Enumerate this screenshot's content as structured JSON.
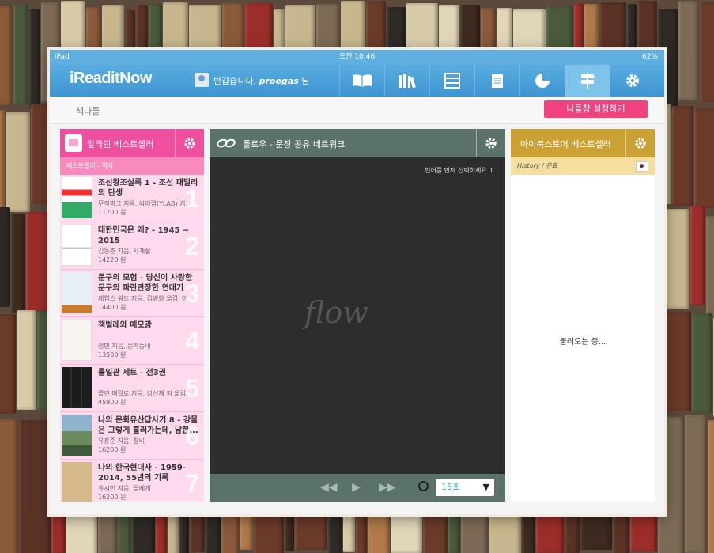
{
  "status_bar": {
    "device": "iPad",
    "time": "오전 10:46",
    "battery": "62%"
  },
  "header": {
    "logo": "iReaditNow",
    "greeting": "반갑습니다,",
    "username": "proegas",
    "honorific": "님"
  },
  "nav_tabs": [
    "book-icon",
    "library-icon",
    "shelf-icon",
    "notes-icon",
    "chart-icon",
    "signpost-icon",
    "settings-icon"
  ],
  "subbar": {
    "title": "책나들",
    "setup_button": "나들창 설정하기"
  },
  "left_panel": {
    "title": "알라딘 베스트셀러",
    "subtitle": "베스트셀러 - 역사",
    "items": [
      {
        "rank": "1",
        "title": "조선왕조실록 1 - 조선 패밀리의 탄생",
        "author": "무적핑크 지음, 와이랩(YLAB) 기...",
        "price": "11700 원"
      },
      {
        "rank": "2",
        "title": "대한민국은 왜? - 1945 ~ 2015",
        "author": "김동춘 지음, 사계절",
        "price": "14220 원"
      },
      {
        "rank": "3",
        "title": "문구의 모험 - 당신이 사랑한 문구의 파란만장한 연대기",
        "author": "제임스 워드 지음, 김병화 옮김, 어...",
        "price": "14400 원"
      },
      {
        "rank": "4",
        "title": "책벌레와 메모광",
        "author": "정민 지음, 문학동네",
        "price": "13500 원"
      },
      {
        "rank": "5",
        "title": "롤일관 세트 - 전3권",
        "author": "콜린 매컬로 지음, 강선재 외 옮김...",
        "price": "45900 원"
      },
      {
        "rank": "6",
        "title": "나의 문화유산답사기 8 - 강물은 그렇게 흘러가는데, 남한...",
        "author": "유홍준 지음, 창비",
        "price": "16200 원"
      },
      {
        "rank": "7",
        "title": "나의 한국현대사 - 1959-2014, 55년의 기록",
        "author": "유시민 지음, 돌베개",
        "price": "16200 원"
      }
    ]
  },
  "center_panel": {
    "title": "플로우 - 문장 공유 네트워크",
    "hint": "언어를 먼저 선택하세요",
    "logo_text": "flow",
    "interval": "15초"
  },
  "right_panel": {
    "title": "아이북스토어 베스트셀러",
    "subtitle": "History / 유료",
    "loading": "불러오는 중..."
  },
  "colors": {
    "pink": "#ee4f9e",
    "green": "#5b7268",
    "gold": "#caa132",
    "blue": "#4aa2dc",
    "setup": "#f0427f"
  }
}
